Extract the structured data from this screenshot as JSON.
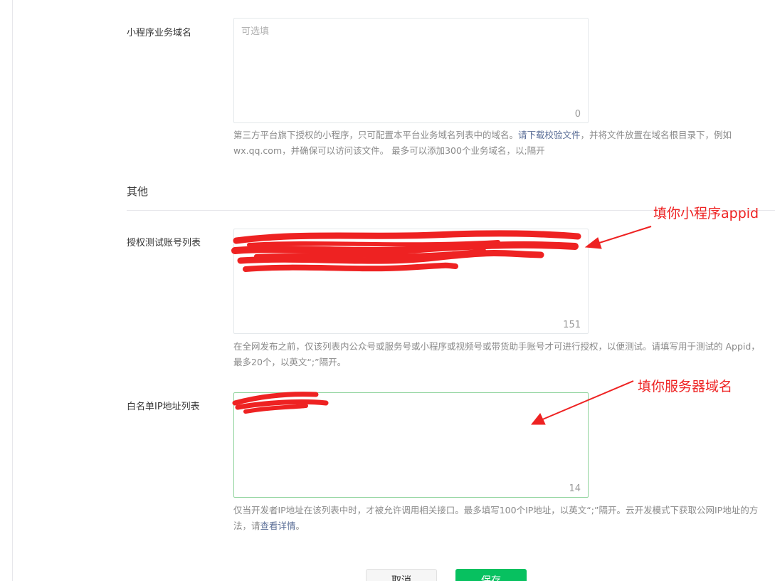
{
  "business_domain": {
    "label": "小程序业务域名",
    "placeholder": "可选填",
    "value": "",
    "count": "0",
    "help_pre": "第三方平台旗下授权的小程序，只可配置本平台业务域名列表中的域名。",
    "help_link": "请下载校验文件",
    "help_post": "，并将文件放置在域名根目录下，例如wx.qq.com，并确保可以访问该文件。 最多可以添加300个业务域名，以;隔开"
  },
  "section": {
    "title": "其他"
  },
  "test_accounts": {
    "label": "授权测试账号列表",
    "value": "",
    "count": "151",
    "help": "在全网发布之前，仅该列表内公众号或服务号或小程序或视频号或带货助手账号才可进行授权，以便测试。请填写用于测试的 Appid，最多20个，以英文“;”隔开。"
  },
  "ip_whitelist": {
    "label": "白名单IP地址列表",
    "value": "",
    "count": "14",
    "help_pre": "仅当开发者IP地址在该列表中时，才被允许调用相关接口。最多填写100个IP地址，以英文“;”隔开。云开发模式下获取公网IP地址的方法，请",
    "help_link": "查看详情",
    "help_post": "。"
  },
  "annotations": {
    "appid": "填你小程序appid",
    "server": "填你服务器域名"
  },
  "buttons": {
    "cancel": "取消",
    "save": "保存"
  },
  "colors": {
    "primary": "#07c160",
    "link": "#576b95",
    "annotation": "#ee2222",
    "focus_border": "#8fd39c"
  }
}
